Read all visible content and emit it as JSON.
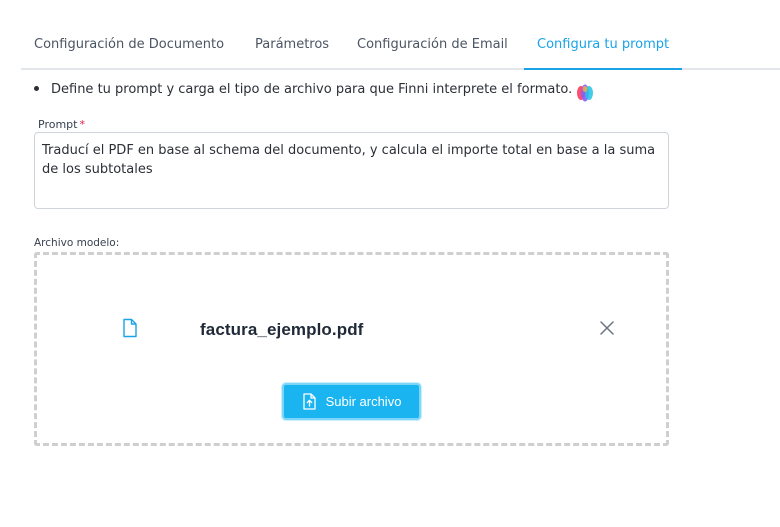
{
  "tabs": [
    {
      "label": "Configuración de Documento"
    },
    {
      "label": "Parámetros"
    },
    {
      "label": "Configuración de Email"
    },
    {
      "label": "Configura tu prompt"
    }
  ],
  "active_tab": "Configura tu prompt",
  "intro_text": "Define tu prompt y carga el tipo de archivo para que Finni interprete el formato.",
  "prompt": {
    "label": "Prompt",
    "required_mark": "*",
    "value": "Traducí el PDF en base al schema del documento, y calcula el importe total en base a la suma de los subtotales"
  },
  "file_upload": {
    "label": "Archivo modelo:",
    "file_name": "factura_ejemplo.pdf",
    "file_icon": "file-icon",
    "remove_icon": "close-icon",
    "button_label": "Subir archivo",
    "button_icon": "file-upload-icon"
  },
  "colors": {
    "accent": "#1aa3e8",
    "button": "#1ab5f1",
    "required": "#e11d48"
  }
}
